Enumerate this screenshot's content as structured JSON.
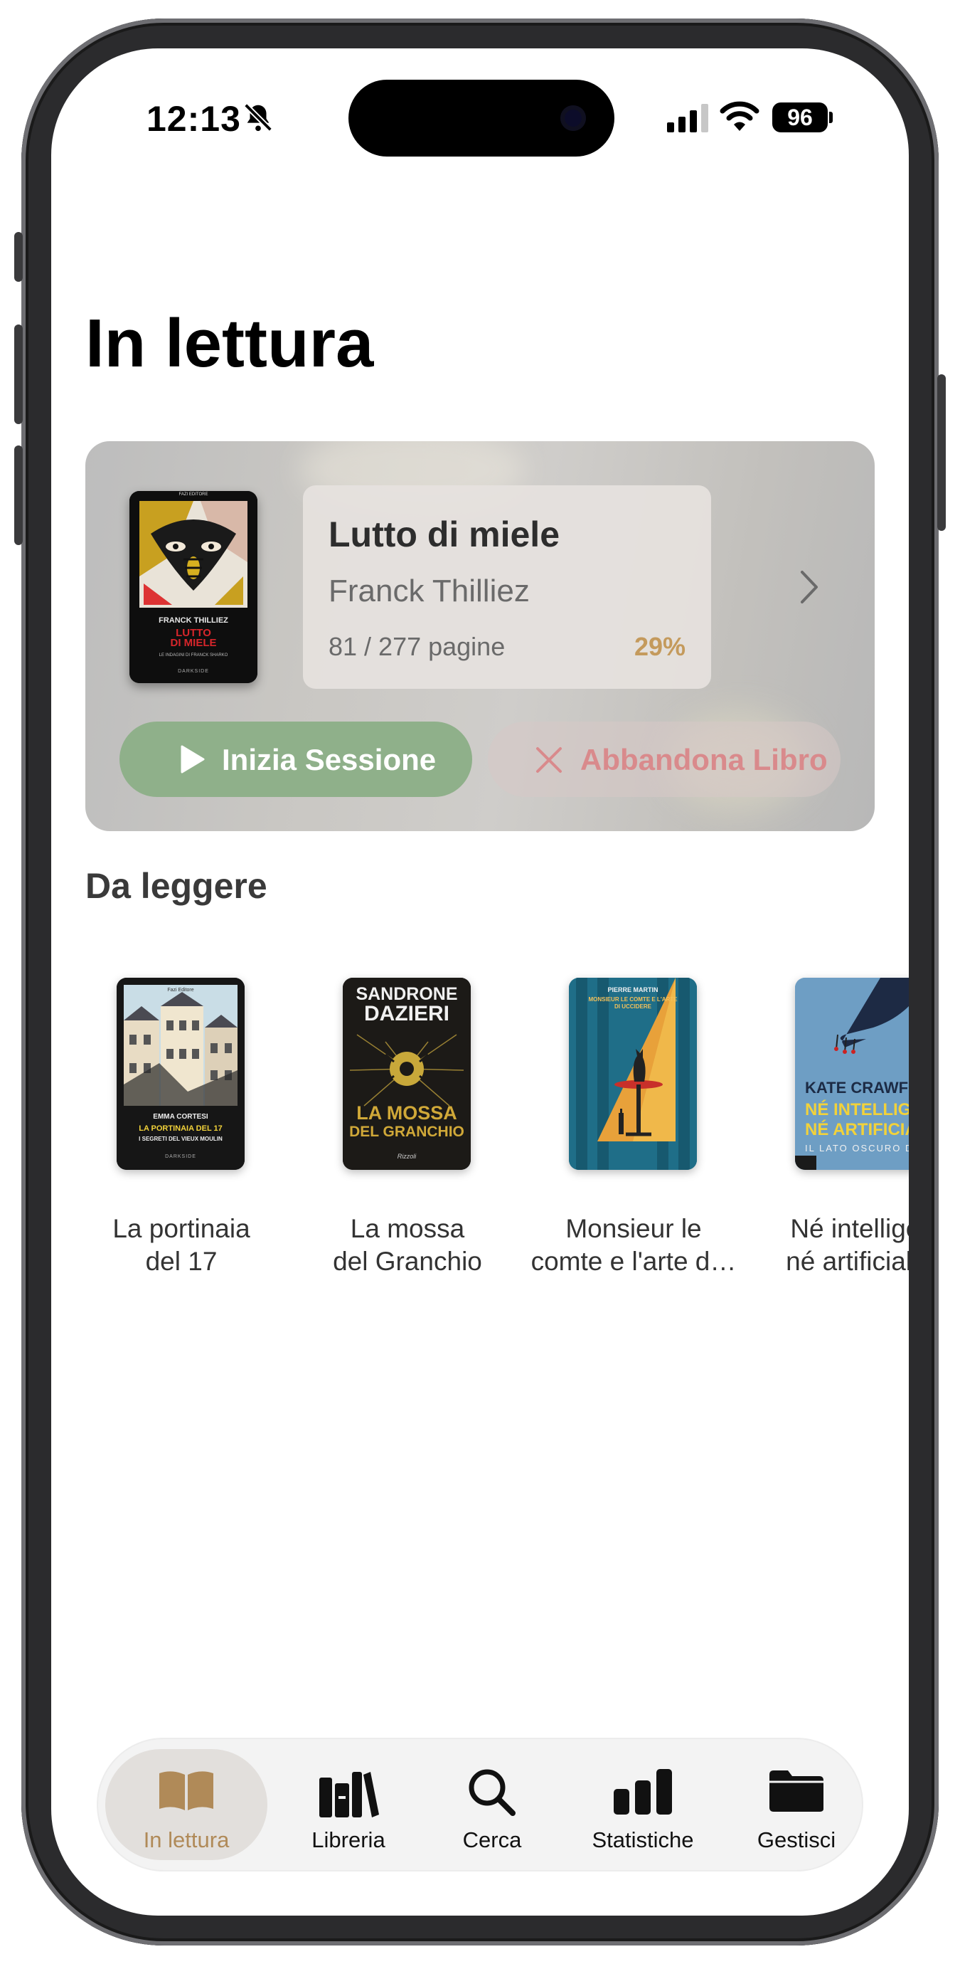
{
  "status_bar": {
    "time": "12:13",
    "battery": "96",
    "icons": [
      "bell-slash-icon",
      "signal-icon",
      "wifi-icon",
      "battery-icon"
    ]
  },
  "header": {
    "title": "In lettura"
  },
  "current_book": {
    "title": "Lutto di miele",
    "author": "Franck Thilliez",
    "pages": "81 / 277 pagine",
    "percent": "29%",
    "progress": 0.29,
    "cover": {
      "author": "FRANCK THILLIEZ",
      "title_line1": "LUTTO",
      "title_line2": "DI MIELE",
      "subtitle": "LE INDAGINI DI FRANCK SHARKO",
      "publisher": "FAZI EDITORE",
      "imprint": "DARKSIDE"
    },
    "start_button": "Inizia Sessione",
    "abandon_button": "Abbandona Libro"
  },
  "to_read": {
    "title": "Da leggere",
    "items": [
      {
        "label": "La portinaia\ndel 17",
        "cover": {
          "publisher": "Fazi Editore",
          "author": "EMMA CORTESI",
          "title": "LA PORTINAIA DEL 17",
          "subtitle": "I SEGRETI DEL VIEUX MOULIN",
          "imprint": "DARKSIDE"
        }
      },
      {
        "label": "La mossa\ndel Granchio",
        "cover": {
          "author_line1": "SANDRONE",
          "author_line2": "DAZIERI",
          "title_line1": "LA MOSSA",
          "title_line2": "DEL GRANCHIO",
          "publisher": "Rizzoli"
        }
      },
      {
        "label": "Monsieur le\ncomte e l'arte d…",
        "cover": {
          "author": "PIERRE MARTIN",
          "title": "MONSIEUR LE COMTE E L'ARTE DI UCCIDERE"
        }
      },
      {
        "label": "Né intelliger\nné artificiale.",
        "cover": {
          "author": "KATE CRAWFORD",
          "title_line1": "NÉ INTELLIGENTI",
          "title_line2": "NÉ ARTIFICIALI",
          "subtitle": "IL LATO OSCURO DELL'I"
        }
      }
    ]
  },
  "tabbar": {
    "tabs": [
      {
        "label": "In lettura",
        "icon": "open-book-icon",
        "active": true
      },
      {
        "label": "Libreria",
        "icon": "books-icon",
        "active": false
      },
      {
        "label": "Cerca",
        "icon": "search-icon",
        "active": false
      },
      {
        "label": "Statistiche",
        "icon": "chart-icon",
        "active": false
      },
      {
        "label": "Gestisci",
        "icon": "folder-icon",
        "active": false
      }
    ]
  },
  "colors": {
    "accent": "#b08a58",
    "start_button": "#8fb08a",
    "abandon_text": "#d98a8c",
    "percent": "#c49a5c"
  }
}
